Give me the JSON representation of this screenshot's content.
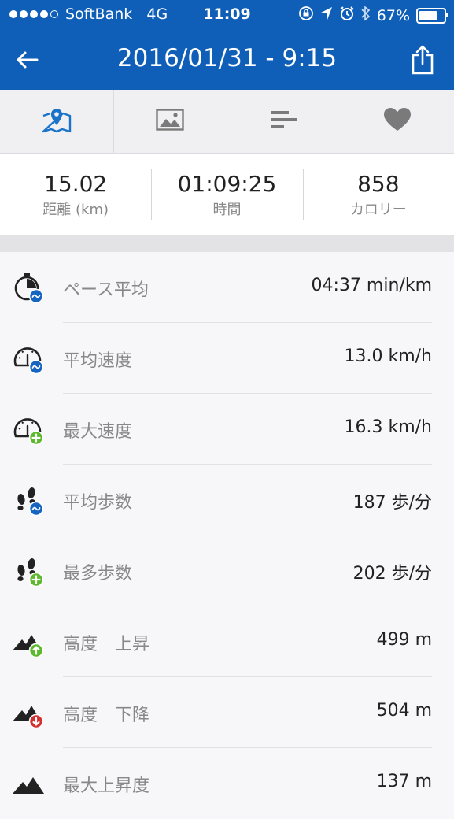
{
  "status_bar": {
    "carrier": "SoftBank",
    "network": "4G",
    "time": "11:09",
    "battery": "67%",
    "signal_bars": 4,
    "signal_max": 5
  },
  "header": {
    "title": "2016/01/31 - 9:15",
    "back_icon": "back-arrow-icon",
    "share_icon": "share-icon",
    "background_color": "#0f5fb8"
  },
  "tabs": [
    {
      "name": "map",
      "icon": "map-pin-icon",
      "active": true
    },
    {
      "name": "photos",
      "icon": "image-icon",
      "active": false
    },
    {
      "name": "splits",
      "icon": "bar-list-icon",
      "active": false
    },
    {
      "name": "heart",
      "icon": "heart-icon",
      "active": false
    }
  ],
  "summary": [
    {
      "value": "15.02",
      "label": "距離 (km)"
    },
    {
      "value": "01:09:25",
      "label": "時間"
    },
    {
      "value": "858",
      "label": "カロリー"
    }
  ],
  "stats": [
    {
      "label": "ペース平均",
      "value": "04:37 min/km",
      "icon": "stopwatch-average-icon"
    },
    {
      "label": "平均速度",
      "value": "13.0 km/h",
      "icon": "speedometer-average-icon"
    },
    {
      "label": "最大速度",
      "value": "16.3 km/h",
      "icon": "speedometer-max-icon"
    },
    {
      "label": "平均歩数",
      "value": "187 歩/分",
      "icon": "footsteps-average-icon"
    },
    {
      "label": "最多歩数",
      "value": "202 歩/分",
      "icon": "footsteps-max-icon"
    },
    {
      "label": "高度　上昇",
      "value": "499 m",
      "icon": "mountain-ascent-icon"
    },
    {
      "label": "高度　下降",
      "value": "504 m",
      "icon": "mountain-descent-icon"
    },
    {
      "label": "最大上昇度",
      "value": "137 m",
      "icon": "mountain-icon"
    }
  ],
  "colors": {
    "blue_badge": "#1565c0",
    "green_badge": "#5cb82d",
    "red_badge": "#d32f2f",
    "active_tab": "#1a73c8"
  }
}
